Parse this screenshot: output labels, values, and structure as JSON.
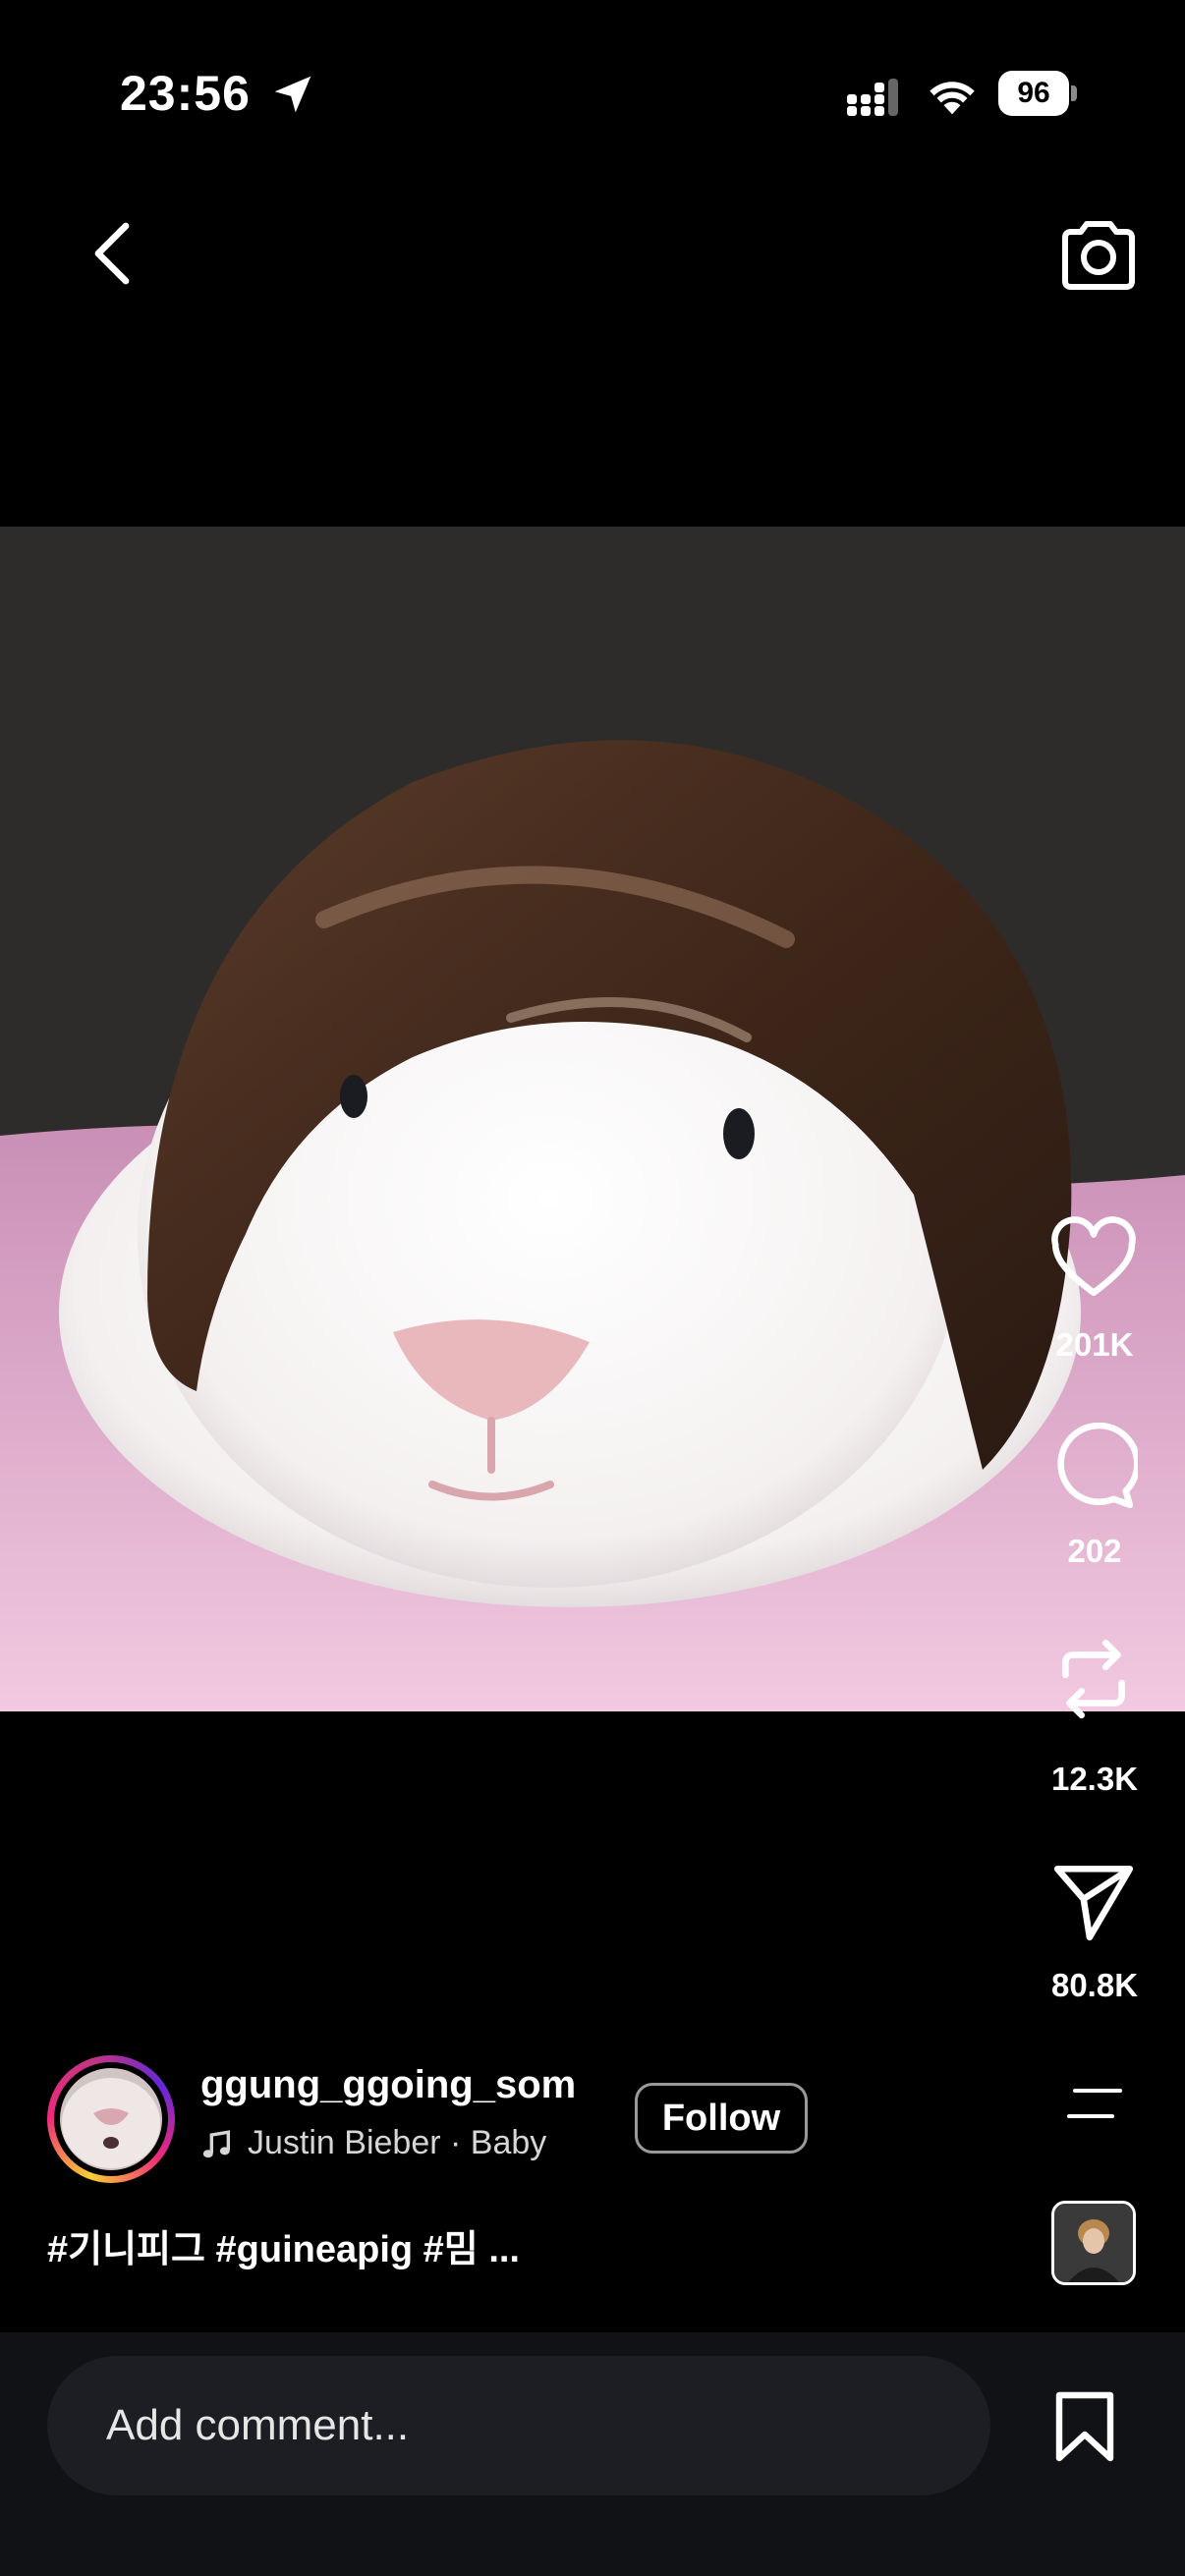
{
  "status_bar": {
    "time": "23:56",
    "battery": "96",
    "icons": [
      "location-arrow-icon",
      "cellular-signal-icon",
      "wifi-icon",
      "battery-icon"
    ]
  },
  "header": {
    "back_icon": "chevron-left-icon",
    "camera_icon": "camera-icon"
  },
  "rail": {
    "likes": "201K",
    "comments": "202",
    "reposts": "12.3K",
    "shares": "80.8K",
    "icons": [
      "heart-icon",
      "comment-bubble-icon",
      "repost-icon",
      "send-icon"
    ]
  },
  "post": {
    "username": "ggung_ggoing_som",
    "audio": "Justin Bieber · Baby",
    "follow_label": "Follow",
    "caption": "#기니피그 #guineapig #밈 ..."
  },
  "comment_bar": {
    "placeholder": "Add comment...",
    "bookmark_icon": "bookmark-icon"
  },
  "colors": {
    "background": "#000000",
    "bottom_bar": "#111216",
    "input": "#1c1e23"
  }
}
